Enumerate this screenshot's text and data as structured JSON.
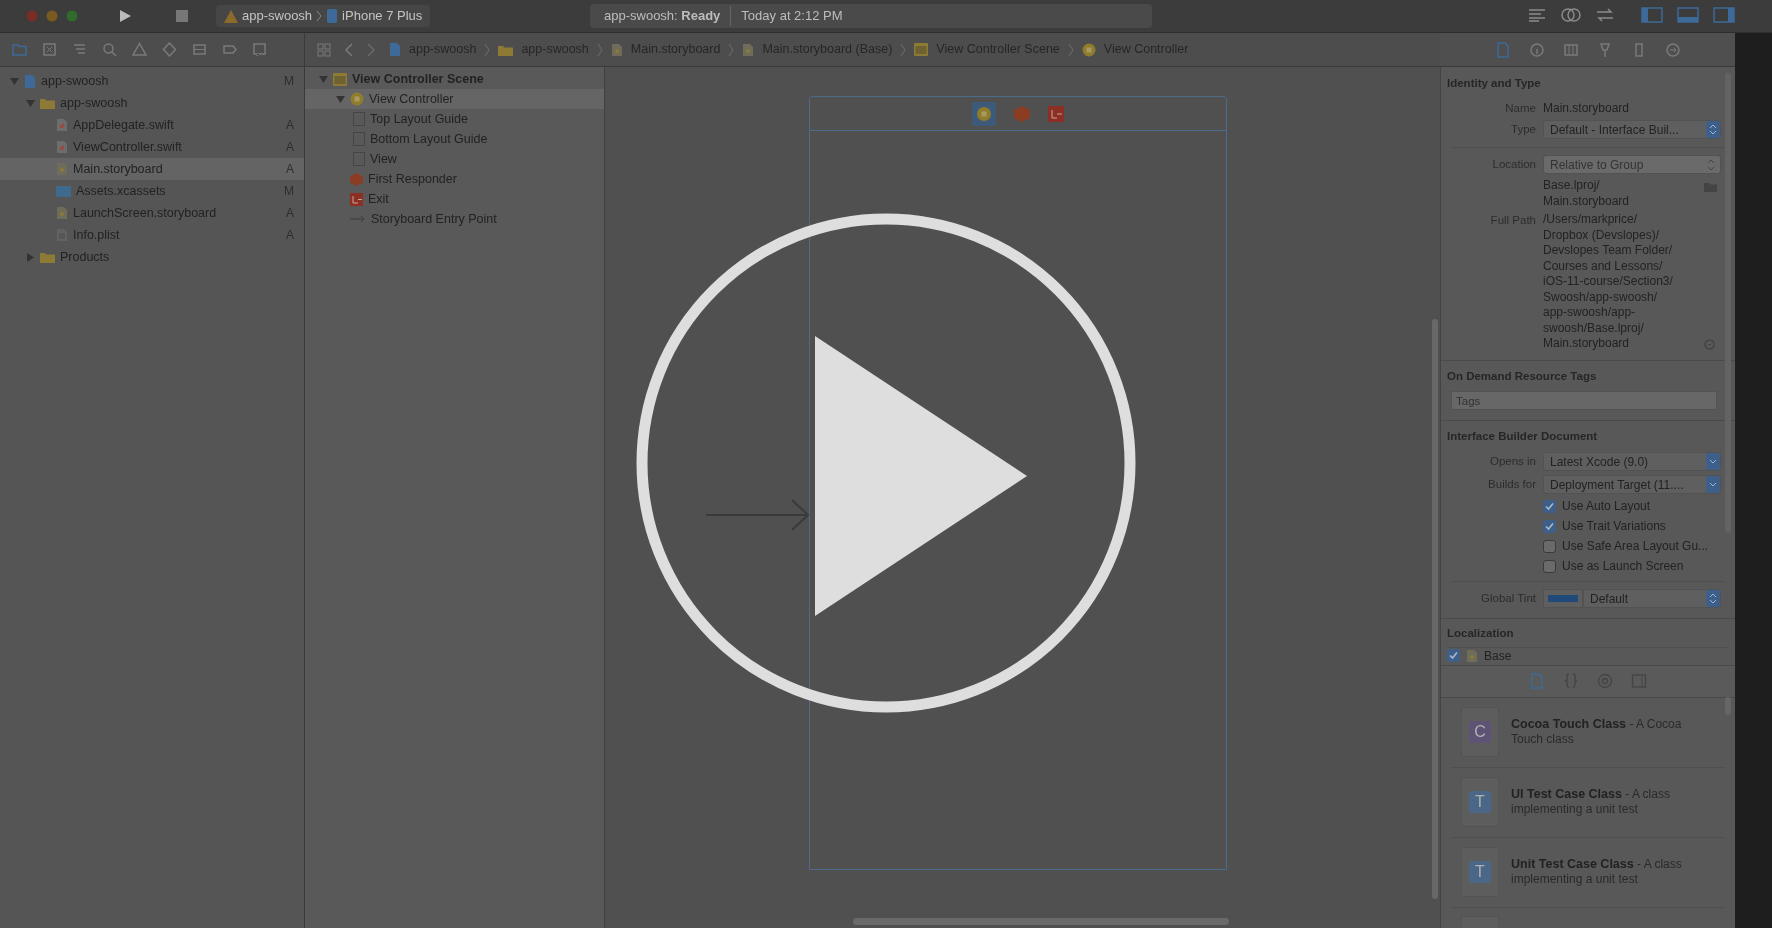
{
  "toolbar": {
    "scheme": "app-swoosh",
    "device": "iPhone 7 Plus",
    "status": "app-swoosh: **Ready**",
    "time": "Today at 2:12 PM"
  },
  "navigator_tabs": [
    {
      "selected": true
    },
    {
      "selected": false
    },
    {
      "selected": false
    },
    {
      "selected": false
    },
    {
      "selected": false
    },
    {
      "selected": false
    },
    {
      "selected": false
    },
    {
      "selected": false
    },
    {
      "selected": false
    }
  ],
  "jump_bar": [
    {
      "kind": "project",
      "label": "app-swoosh"
    },
    {
      "kind": "folder",
      "label": "app-swoosh"
    },
    {
      "kind": "storyboard",
      "label": "Main.storyboard"
    },
    {
      "kind": "storyboard",
      "label": "Main.storyboard (Base)"
    },
    {
      "kind": "scene",
      "label": "View Controller Scene"
    },
    {
      "kind": "controller",
      "label": "View Controller"
    }
  ],
  "inspector_tabs": [
    {
      "selected": true
    },
    {
      "selected": false
    },
    {
      "selected": false
    },
    {
      "selected": false
    },
    {
      "selected": false
    },
    {
      "selected": false
    }
  ],
  "navigator": [
    {
      "kind": "project",
      "label": "app-swoosh",
      "badge": "M",
      "selected": false,
      "expanded": true,
      "children": [
        {
          "kind": "folder",
          "label": "app-swoosh",
          "selected": false,
          "expanded": true,
          "children": [
            {
              "kind": "swift",
              "label": "AppDelegate.swift",
              "badge": "A",
              "selected": false
            },
            {
              "kind": "swift",
              "label": "ViewController.swift",
              "badge": "A",
              "selected": false
            },
            {
              "kind": "storyboard",
              "label": "Main.storyboard",
              "badge": "A",
              "selected": true
            },
            {
              "kind": "assets",
              "label": "Assets.xcassets",
              "badge": "M",
              "selected": false
            },
            {
              "kind": "storyboard",
              "label": "LaunchScreen.storyboard",
              "badge": "A",
              "selected": false
            },
            {
              "kind": "plist",
              "label": "Info.plist",
              "badge": "A",
              "selected": false
            }
          ]
        },
        {
          "kind": "folder",
          "label": "Products",
          "selected": false,
          "expanded": false
        }
      ]
    }
  ],
  "outline": [
    {
      "kind": "scene",
      "label": "View Controller Scene",
      "selected": false,
      "expanded": true,
      "children": [
        {
          "kind": "controller",
          "label": "View Controller",
          "selected": true,
          "expanded": true,
          "children": [
            {
              "kind": "guide",
              "label": "Top Layout Guide",
              "selected": false
            },
            {
              "kind": "guide",
              "label": "Bottom Layout Guide",
              "selected": false
            },
            {
              "kind": "guide",
              "label": "View",
              "selected": false
            }
          ]
        },
        {
          "kind": "responder",
          "label": "First Responder",
          "selected": false
        },
        {
          "kind": "exit",
          "label": "Exit",
          "selected": false
        },
        {
          "kind": "entry",
          "label": "Storyboard Entry Point",
          "selected": false
        }
      ]
    }
  ],
  "identity": {
    "title": "Identity and Type",
    "name_label": "Name",
    "name": "Main.storyboard",
    "type_label": "Type",
    "type": "Default - Interface Buil...",
    "location_label": "Location",
    "location": "Relative to Group",
    "location_path": [
      "Base.lproj/",
      "Main.storyboard"
    ],
    "full_path_label": "Full Path",
    "full_path": [
      "/Users/markprice/",
      "Dropbox (Devslopes)/",
      "Devslopes Team Folder/",
      "Courses and Lessons/",
      "iOS-11-course/Section3/",
      "Swoosh/app-swoosh/",
      "app-swoosh/app-",
      "swoosh/Base.lproj/",
      "Main.storyboard"
    ]
  },
  "resource_tags": {
    "title": "On Demand Resource Tags",
    "placeholder": "Tags"
  },
  "ib_document": {
    "title": "Interface Builder Document",
    "opens_in_label": "Opens in",
    "opens_in": "Latest Xcode (9.0)",
    "builds_for_label": "Builds for",
    "builds_for": "Deployment Target (11....",
    "options": [
      {
        "label": "Use Auto Layout",
        "checked": true
      },
      {
        "label": "Use Trait Variations",
        "checked": true
      },
      {
        "label": "Use Safe Area Layout Gu...",
        "checked": false
      },
      {
        "label": "Use as Launch Screen",
        "checked": false
      }
    ],
    "tint_label": "Global Tint",
    "tint": "Default"
  },
  "localization": {
    "title": "Localization",
    "items": [
      {
        "label": "Base",
        "checked": true
      }
    ]
  },
  "library_tabs": [
    {
      "kind": "file",
      "selected": true
    },
    {
      "kind": "code",
      "selected": false
    },
    {
      "kind": "object",
      "selected": false
    },
    {
      "kind": "media",
      "selected": false
    }
  ],
  "library": [
    {
      "letter": "C",
      "color": "#5e5275",
      "title": "Cocoa Touch Class",
      "description": "- A Cocoa Touch class"
    },
    {
      "letter": "T",
      "color": "#4a6787",
      "title": "UI Test Case Class",
      "description": "- A class implementing a unit test"
    },
    {
      "letter": "T",
      "color": "#4a6787",
      "title": "Unit Test Case Class",
      "description": "- A class implementing a unit test"
    }
  ]
}
